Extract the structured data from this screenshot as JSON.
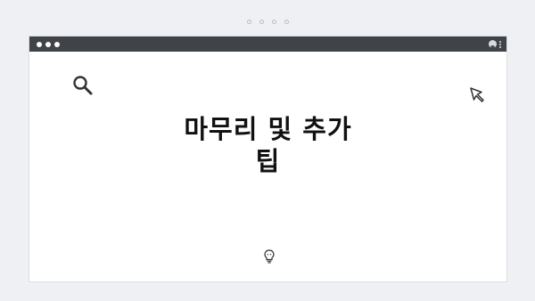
{
  "page": {
    "top_indicator_count": 4
  },
  "window": {
    "titlebar": {
      "controls": [
        "circle-dot",
        "circle-dot",
        "circle-dot"
      ],
      "right_icons": [
        "user-icon",
        "kebab-menu-icon"
      ]
    },
    "slide": {
      "title_lines": [
        "마무리 및 추가",
        "팁"
      ],
      "icons": [
        "search-icon",
        "cursor-arrow-icon",
        "lightbulb-icon"
      ]
    }
  },
  "colors": {
    "page_bg": "#eef0f3",
    "titlebar": "#404348",
    "window_bg": "#ffffff",
    "text": "#111111",
    "icon_stroke": "#333333"
  }
}
